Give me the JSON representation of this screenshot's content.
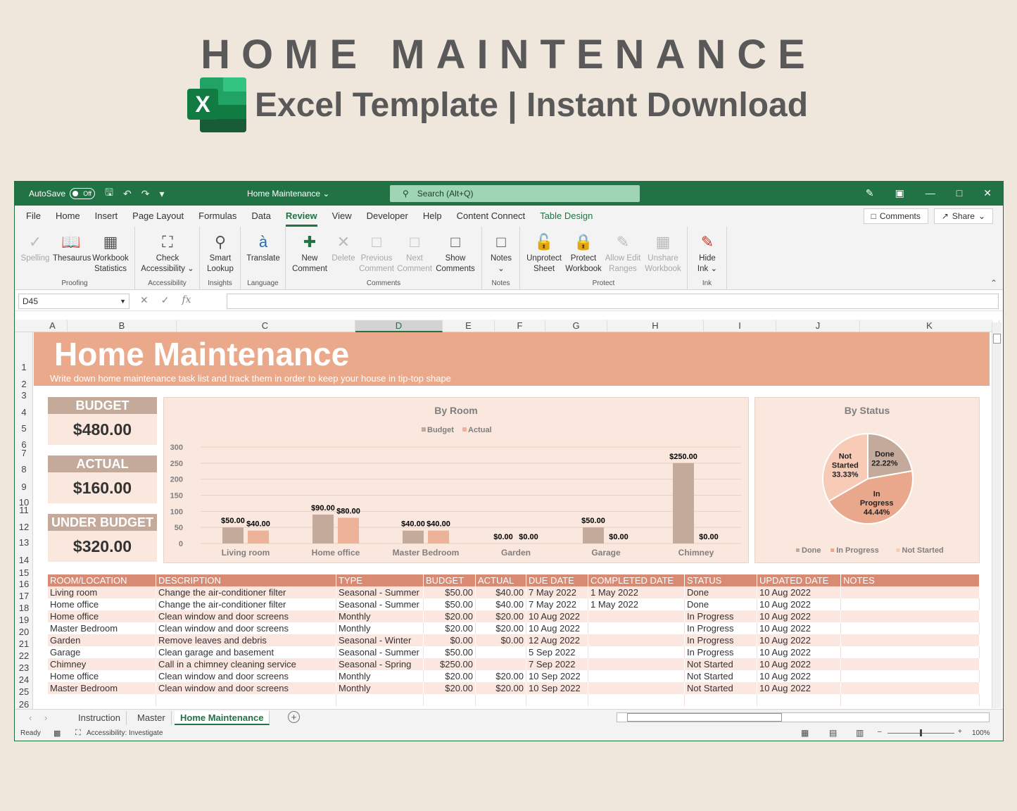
{
  "hero": {
    "title": "HOME MAINTENANCE",
    "subtitle": "Excel Template | Instant Download",
    "logo_letter": "X"
  },
  "titlebar": {
    "autosave": "AutoSave",
    "toggle": "Off",
    "doc_name": "Home Maintenance ⌄",
    "search": "Search (Alt+Q)"
  },
  "menu": {
    "tabs": [
      "File",
      "Home",
      "Insert",
      "Page Layout",
      "Formulas",
      "Data",
      "Review",
      "View",
      "Developer",
      "Help",
      "Content Connect",
      "Table Design"
    ],
    "comments": "Comments",
    "share": "Share"
  },
  "ribbon": {
    "groups": {
      "proofing": "Proofing",
      "accessibility": "Accessibility",
      "insights": "Insights",
      "language": "Language",
      "comments": "Comments",
      "notes": "Notes",
      "protect": "Protect",
      "ink": "Ink"
    },
    "buttons": {
      "spelling": "Spelling",
      "thesaurus": "Thesaurus",
      "workbook_stats_1": "Workbook",
      "workbook_stats_2": "Statistics",
      "check_acc_1": "Check",
      "check_acc_2": "Accessibility ⌄",
      "smart_lookup_1": "Smart",
      "smart_lookup_2": "Lookup",
      "translate": "Translate",
      "new_comment_1": "New",
      "new_comment_2": "Comment",
      "delete": "Delete",
      "previous_1": "Previous",
      "previous_2": "Comment",
      "next_1": "Next",
      "next_2": "Comment",
      "show_1": "Show",
      "show_2": "Comments",
      "notes": "Notes",
      "notes_caret": "⌄",
      "unprotect_1": "Unprotect",
      "unprotect_2": "Sheet",
      "protect_wb_1": "Protect",
      "protect_wb_2": "Workbook",
      "allow_edit_1": "Allow Edit",
      "allow_edit_2": "Ranges",
      "unshare_1": "Unshare",
      "unshare_2": "Workbook",
      "hide_ink_1": "Hide",
      "hide_ink_2": "Ink ⌄"
    }
  },
  "formula_bar": {
    "name_box": "D45",
    "fx": "fx"
  },
  "columns": [
    "A",
    "B",
    "C",
    "D",
    "E",
    "F",
    "G",
    "H",
    "I",
    "J",
    "K"
  ],
  "rows": [
    "1",
    "2",
    "3",
    "4",
    "5",
    "6",
    "7",
    "8",
    "9",
    "10",
    "11",
    "12",
    "13",
    "14",
    "15",
    "16",
    "17",
    "18",
    "19",
    "20",
    "21",
    "22",
    "23",
    "24",
    "25",
    "26"
  ],
  "sheet": {
    "title": "Home Maintenance",
    "subtitle": "Write down home maintenance task list and track them in order to keep your house in tip-top shape",
    "kpis": [
      {
        "label": "BUDGET",
        "value": "$480.00"
      },
      {
        "label": "ACTUAL",
        "value": "$160.00"
      },
      {
        "label": "UNDER BUDGET",
        "value": "$320.00"
      }
    ]
  },
  "chart_data": [
    {
      "type": "bar",
      "title": "By Room",
      "categories": [
        "Living room",
        "Home office",
        "Master Bedroom",
        "Garden",
        "Garage",
        "Chimney"
      ],
      "series": [
        {
          "name": "Budget",
          "values": [
            50,
            90,
            40,
            0,
            50,
            250
          ],
          "labels": [
            "$50.00",
            "$90.00",
            "$40.00",
            "$0.00",
            "$50.00",
            "$250.00"
          ],
          "color": "#c3aa9b"
        },
        {
          "name": "Actual",
          "values": [
            40,
            80,
            40,
            0,
            0,
            0
          ],
          "labels": [
            "$40.00",
            "$80.00",
            "$40.00",
            "$0.00",
            "$0.00",
            "$0.00"
          ],
          "color": "#edb399"
        }
      ],
      "ylim": [
        0,
        300
      ],
      "yticks": [
        "300",
        "250",
        "200",
        "150",
        "100",
        "50",
        "0"
      ],
      "grid": true,
      "legend": "top"
    },
    {
      "type": "pie",
      "title": "By Status",
      "categories": [
        "Done",
        "In Progress",
        "Not Started"
      ],
      "values": [
        22.22,
        44.44,
        33.33
      ],
      "labels": [
        [
          "Done",
          "22.22%"
        ],
        [
          "In",
          "Progress",
          "44.44%"
        ],
        [
          "Not",
          "Started",
          "33.33%"
        ]
      ],
      "colors": [
        "#c3aa9b",
        "#e9a88b",
        "#f7cbb6"
      ],
      "legend": "bottom"
    }
  ],
  "table": {
    "headers": [
      "ROOM/LOCATION",
      "DESCRIPTION",
      "TYPE",
      "BUDGET",
      "ACTUAL",
      "DUE DATE",
      "COMPLETED DATE",
      "STATUS",
      "UPDATED DATE",
      "NOTES"
    ],
    "rows": [
      [
        "Living room",
        "Change the air-conditioner filter",
        "Seasonal - Summer",
        "$50.00",
        "$40.00",
        "7 May 2022",
        "1 May 2022",
        "Done",
        "10 Aug 2022",
        ""
      ],
      [
        "Home office",
        "Change the air-conditioner filter",
        "Seasonal - Summer",
        "$50.00",
        "$40.00",
        "7 May 2022",
        "1 May 2022",
        "Done",
        "10 Aug 2022",
        ""
      ],
      [
        "Home office",
        "Clean window and door screens",
        "Monthly",
        "$20.00",
        "$20.00",
        "10 Aug 2022",
        "",
        "In Progress",
        "10 Aug 2022",
        ""
      ],
      [
        "Master Bedroom",
        "Clean window and door screens",
        "Monthly",
        "$20.00",
        "$20.00",
        "10 Aug 2022",
        "",
        "In Progress",
        "10 Aug 2022",
        ""
      ],
      [
        "Garden",
        "Remove leaves and debris",
        "Seasonal - Winter",
        "$0.00",
        "$0.00",
        "12 Aug 2022",
        "",
        "In Progress",
        "10 Aug 2022",
        ""
      ],
      [
        "Garage",
        "Clean garage and basement",
        "Seasonal - Summer",
        "$50.00",
        "",
        "5 Sep 2022",
        "",
        "In Progress",
        "10 Aug 2022",
        ""
      ],
      [
        "Chimney",
        "Call in a chimney cleaning service",
        "Seasonal - Spring",
        "$250.00",
        "",
        "7 Sep 2022",
        "",
        "Not Started",
        "10 Aug 2022",
        ""
      ],
      [
        "Home office",
        "Clean window and door screens",
        "Monthly",
        "$20.00",
        "$20.00",
        "10 Sep 2022",
        "",
        "Not Started",
        "10 Aug 2022",
        ""
      ],
      [
        "Master Bedroom",
        "Clean window and door screens",
        "Monthly",
        "$20.00",
        "$20.00",
        "10 Sep 2022",
        "",
        "Not Started",
        "10 Aug 2022",
        ""
      ]
    ]
  },
  "sheet_tabs": [
    "Instruction",
    "Master",
    "Home Maintenance"
  ],
  "status": {
    "ready": "Ready",
    "accessibility": "Accessibility: Investigate",
    "zoom": "100%"
  }
}
